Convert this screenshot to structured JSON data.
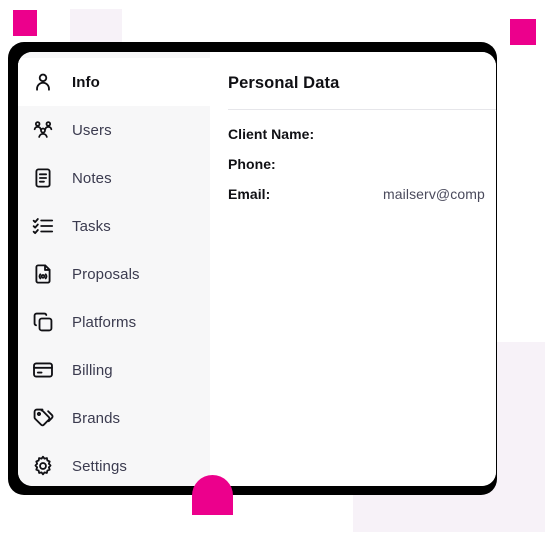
{
  "theme": {
    "accent_pink": "#ec008c",
    "lavender": "#f7f2f8",
    "frame_black": "#000000",
    "sidebar_bg": "#f7f7f8",
    "card_bg": "#ffffff",
    "text_dark": "#101014",
    "text_muted": "#3b3b4f",
    "divider": "#e6e6ea"
  },
  "sidebar": {
    "items": [
      {
        "label": "Info",
        "icon": "user-icon",
        "active": true
      },
      {
        "label": "Users",
        "icon": "users-group-icon",
        "active": false
      },
      {
        "label": "Notes",
        "icon": "note-icon",
        "active": false
      },
      {
        "label": "Tasks",
        "icon": "checklist-icon",
        "active": false
      },
      {
        "label": "Proposals",
        "icon": "file-audio-icon",
        "active": false
      },
      {
        "label": "Platforms",
        "icon": "copy-layers-icon",
        "active": false
      },
      {
        "label": "Billing",
        "icon": "credit-card-icon",
        "active": false
      },
      {
        "label": "Brands",
        "icon": "tags-icon",
        "active": false
      },
      {
        "label": "Settings",
        "icon": "gear-icon",
        "active": false
      }
    ]
  },
  "content": {
    "title": "Personal Data",
    "fields": [
      {
        "label": "Client Name:",
        "value": ""
      },
      {
        "label": "Phone:",
        "value": ""
      },
      {
        "label": "Email:",
        "value": "mailserv@comp"
      }
    ]
  }
}
